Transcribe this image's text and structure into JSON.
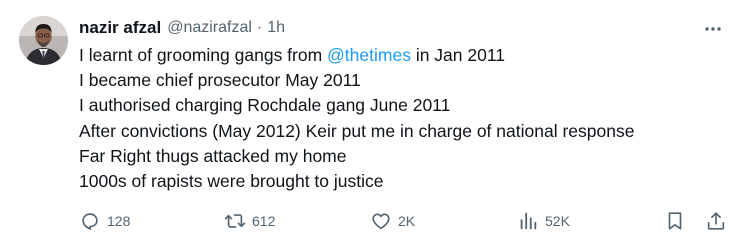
{
  "author": {
    "display_name": "nazir afzal",
    "handle": "@nazirafzal",
    "separator": "·",
    "timestamp": "1h"
  },
  "tweet": {
    "line1_before": "I learnt of grooming gangs from ",
    "line1_mention": "@thetimes",
    "line1_after": " in Jan 2011",
    "lines": [
      "I became chief prosecutor May 2011",
      "I authorised charging Rochdale gang June 2011",
      "After convictions (May 2012) Keir put me in charge of national response",
      "Far Right thugs attacked my home",
      "1000s of rapists were brought to justice"
    ]
  },
  "metrics": {
    "replies": "128",
    "reposts": "612",
    "likes": "2K",
    "views": "52K"
  },
  "icons": {
    "more": "more-horizontal-icon",
    "reply": "reply-icon",
    "repost": "repost-icon",
    "like": "heart-icon",
    "views": "views-chart-icon",
    "bookmark": "bookmark-icon",
    "share": "share-icon"
  },
  "colors": {
    "text": "#0f1419",
    "secondary": "#536471",
    "link": "#1d9bf0",
    "background": "#ffffff"
  }
}
